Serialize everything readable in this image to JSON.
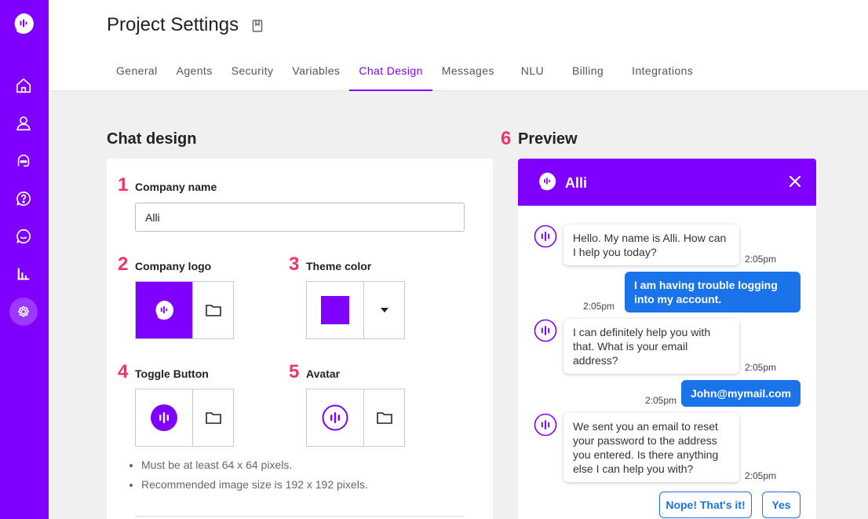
{
  "sidebar": {
    "items": [
      {
        "icon": "logo-icon"
      },
      {
        "icon": "home-icon"
      },
      {
        "icon": "user-icon"
      },
      {
        "icon": "chat-agents-icon"
      },
      {
        "icon": "help-icon"
      },
      {
        "icon": "conversation-icon"
      },
      {
        "icon": "analytics-icon"
      },
      {
        "icon": "settings-icon",
        "active": true
      }
    ]
  },
  "header": {
    "title": "Project Settings",
    "tabs": [
      "General",
      "Agents",
      "Security",
      "Variables",
      "Chat Design",
      "Messages",
      "NLU",
      "Billing",
      "Integrations"
    ],
    "active_tab": "Chat Design"
  },
  "chat_design": {
    "section_title": "Chat design",
    "company_name": {
      "number": "1",
      "label": "Company name",
      "value": "Alli"
    },
    "company_logo": {
      "number": "2",
      "label": "Company logo"
    },
    "theme_color": {
      "number": "3",
      "label": "Theme color",
      "color": "#8000ff"
    },
    "toggle_button": {
      "number": "4",
      "label": "Toggle Button"
    },
    "avatar": {
      "number": "5",
      "label": "Avatar"
    },
    "hints": [
      "Must be at least 64 x 64 pixels.",
      "Recommended image size is 192 x 192 pixels."
    ]
  },
  "preview": {
    "number": "6",
    "section_title": "Preview",
    "header_title": "Alli",
    "messages": [
      {
        "from": "bot",
        "text": "Hello. My name is Alli. How can I help you today?",
        "time": "2:05pm"
      },
      {
        "from": "user",
        "text": "I am having trouble logging into my account.",
        "time": "2:05pm"
      },
      {
        "from": "bot",
        "text": "I can definitely help you with that. What is your email address?",
        "time": "2:05pm"
      },
      {
        "from": "user",
        "text": "John@mymail.com",
        "time": "2:05pm"
      },
      {
        "from": "bot",
        "text": "We sent you an email to reset your password to the address you entered. Is there anything else I can help you with?",
        "time": "2:05pm"
      }
    ],
    "quick_replies": [
      "Nope! That's it!",
      "Yes"
    ]
  },
  "colors": {
    "brand": "#8000ff",
    "accent": "#f0336a",
    "user_bubble": "#1a73e8"
  }
}
